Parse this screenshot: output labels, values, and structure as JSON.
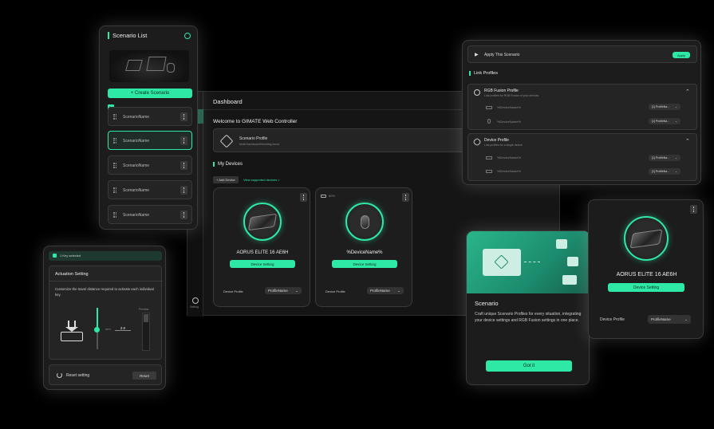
{
  "scenario_list": {
    "title": "Scenario List",
    "create_label": "+ Create Scenario",
    "items": [
      "ScenarioName",
      "ScenarioName",
      "ScenarioName",
      "ScenarioName",
      "ScenarioName"
    ]
  },
  "dashboard": {
    "title": "Dashboard",
    "welcome": "Welcome to GIMATE Web Controller",
    "profile_title": "Scenario Profile",
    "profile_sub": "Multi-Dashboard/Handling boost",
    "my_devices": "My Devices",
    "add_device": "+ Add Device",
    "supported_link": "View supported devices >",
    "setting_label": "Setting",
    "devices": [
      {
        "name": "AORUS ELITE 16 AE6H",
        "button": "Device Setting",
        "profile_label": "Device Profile",
        "profile_value": "ProfileName",
        "battery": ""
      },
      {
        "name": "%DeviceName%",
        "button": "Device Setting",
        "profile_label": "Device Profile",
        "profile_value": "ProfileName",
        "battery": "80%"
      }
    ]
  },
  "link_profiles": {
    "apply_text": "Apply This Scenario",
    "apply_btn": "Apply",
    "section": "Link Profiles",
    "rgb": {
      "title": "RGB Fusion Profile",
      "sub": "Link profiles for RGB Fusion of your devices"
    },
    "device": {
      "title": "Device Profile",
      "sub": "Link profiles for a single device"
    },
    "rows": [
      {
        "name": "%DeviceName%",
        "value": "[1] ProfileNa..."
      },
      {
        "name": "%DeviceName%",
        "value": "[1] ProfileNa..."
      },
      {
        "name": "%DeviceName%",
        "value": "[1] ProfileNa..."
      },
      {
        "name": "%DeviceName%",
        "value": "[1] ProfileNa..."
      }
    ]
  },
  "actuation": {
    "banner": "1 Key selected",
    "title": "Actuation Setting",
    "desc": "Customize the travel distance required to activate each individual key.",
    "mm_label": "mm",
    "mm_value": "2.0",
    "preview": "Preview",
    "reset_label": "Reset setting",
    "reset_btn": "Reset"
  },
  "scenario_intro": {
    "title": "Scenario",
    "desc": "Craft unique Scenario Profiles for every situation, integrating your device settings and RGB Fusion settings in one place.",
    "button": "Got it"
  },
  "device_card": {
    "name": "AORUS ELITE 16 AE6H",
    "button": "Device Setting",
    "profile_label": "Device Profile",
    "profile_value": "ProfileName"
  },
  "colors": {
    "accent": "#2ee8a5",
    "background": "#000000",
    "panel": "#1c1c1c"
  }
}
